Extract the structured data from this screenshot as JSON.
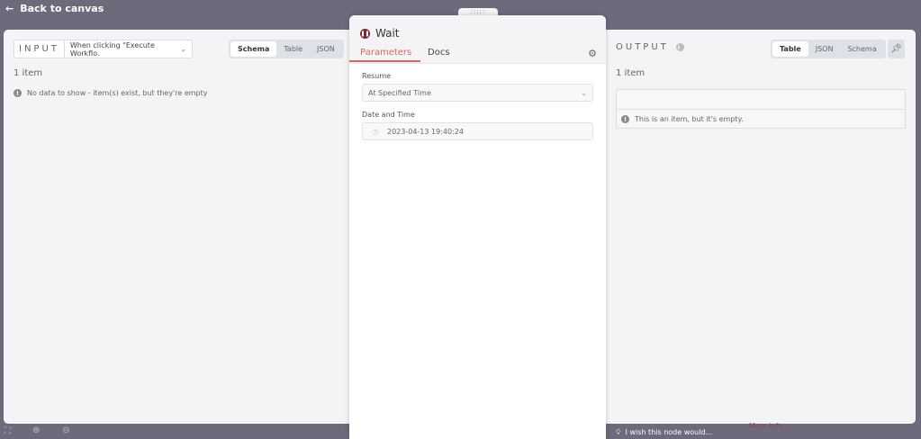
{
  "header": {
    "back_label": "Back to canvas"
  },
  "input": {
    "label": "INPUT",
    "source": "When clicking \"Execute Workflo.",
    "tabs": [
      "Schema",
      "Table",
      "JSON"
    ],
    "active_tab": "Schema",
    "count": "1 item",
    "message": "No data to show - item(s) exist, but they're empty"
  },
  "node": {
    "title": "Wait",
    "tabs": [
      "Parameters",
      "Docs"
    ],
    "active_tab": "Parameters",
    "resume_label": "Resume",
    "resume_value": "At Specified Time",
    "datetime_label": "Date and Time",
    "datetime_value": "2023-04-13 19:40:24",
    "handle": ":::::"
  },
  "output": {
    "label": "OUTPUT",
    "tabs": [
      "Table",
      "JSON",
      "Schema"
    ],
    "active_tab": "Table",
    "count": "1 item",
    "message": "This is an item, but it's empty."
  },
  "footer": {
    "feedback": "I wish this node would...",
    "more_info": "More info"
  },
  "colors": {
    "accent": "#d0685e",
    "background": "#6e6a7c",
    "node_icon": "#7a2a33"
  }
}
